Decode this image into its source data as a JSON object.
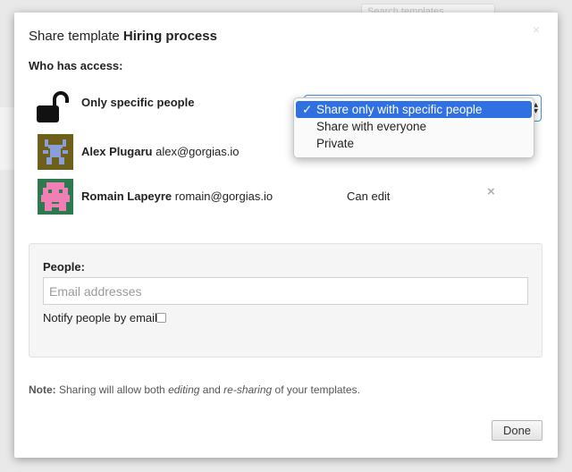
{
  "background": {
    "search_placeholder": "Search templates"
  },
  "modal": {
    "title_prefix": "Share template",
    "title_name": "Hiring process",
    "close_glyph": "×",
    "who_label": "Who has access:",
    "access_icon": "unlocked-padlock-icon",
    "access_text": "Only specific people",
    "access_select": {
      "selected": "Share only with specific people",
      "options": [
        "Share only with specific people",
        "Share with everyone",
        "Private"
      ],
      "check_glyph": "✓"
    },
    "users": [
      {
        "name": "Alex Plugaru",
        "email": "alex@gorgias.io",
        "avatar": "pixel-avatar-icon",
        "avatar_bg": "#6e5f1b",
        "avatar_fg": "#8a9fd8"
      },
      {
        "name": "Romain Lapeyre",
        "email": "romain@gorgias.io",
        "avatar": "pixel-avatar-icon",
        "avatar_bg": "#2e7a4e",
        "avatar_fg": "#f07fb5",
        "permission": "Can edit",
        "remove_glyph": "×"
      }
    ],
    "people": {
      "label": "People:",
      "placeholder": "Email addresses",
      "notify_label": "Notify people by email",
      "notify_checked": false
    },
    "note": {
      "prefix": "Note:",
      "part1": " Sharing will allow both ",
      "em1": "editing",
      "part2": " and ",
      "em2": "re-sharing",
      "part3": " of your templates."
    },
    "done_label": "Done",
    "colors": {
      "select_highlight": "#2f70e3",
      "select_border": "#4a8fde"
    }
  }
}
